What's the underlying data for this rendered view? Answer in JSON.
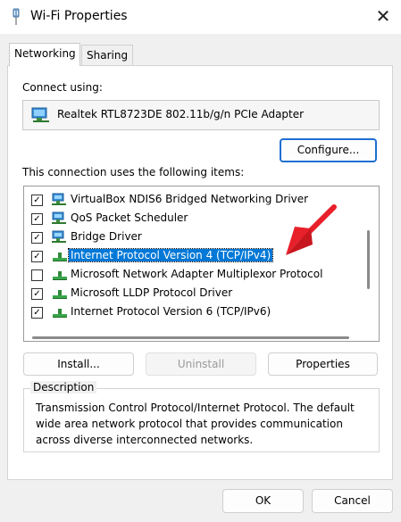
{
  "window": {
    "title": "Wi-Fi Properties",
    "close_glyph": "✕"
  },
  "tabs": [
    {
      "label": "Networking"
    },
    {
      "label": "Sharing"
    }
  ],
  "connect_using": {
    "label": "Connect using:",
    "adapter_name": "Realtek RTL8723DE 802.11b/g/n PCIe Adapter",
    "configure_button": "Configure..."
  },
  "items_label": "This connection uses the following items:",
  "items": [
    {
      "label": "VirtualBox NDIS6 Bridged Networking Driver",
      "checked": true,
      "icon": "network-client-icon"
    },
    {
      "label": "QoS Packet Scheduler",
      "checked": true,
      "icon": "network-client-icon"
    },
    {
      "label": "Bridge Driver",
      "checked": true,
      "icon": "network-client-icon"
    },
    {
      "label": "Internet Protocol Version 4 (TCP/IPv4)",
      "checked": true,
      "icon": "protocol-icon",
      "selected": true
    },
    {
      "label": "Microsoft Network Adapter Multiplexor Protocol",
      "checked": false,
      "icon": "protocol-icon"
    },
    {
      "label": "Microsoft LLDP Protocol Driver",
      "checked": true,
      "icon": "protocol-icon"
    },
    {
      "label": "Internet Protocol Version 6 (TCP/IPv6)",
      "checked": true,
      "icon": "protocol-icon"
    }
  ],
  "buttons": {
    "install": "Install...",
    "uninstall": "Uninstall",
    "properties": "Properties"
  },
  "description": {
    "label": "Description",
    "text": "Transmission Control Protocol/Internet Protocol. The default wide area network protocol that provides communication across diverse interconnected networks."
  },
  "footer": {
    "ok": "OK",
    "cancel": "Cancel"
  },
  "colors": {
    "selection": "#0078d7",
    "arrow": "#e8202a",
    "focus_border": "#1f6fd1"
  }
}
